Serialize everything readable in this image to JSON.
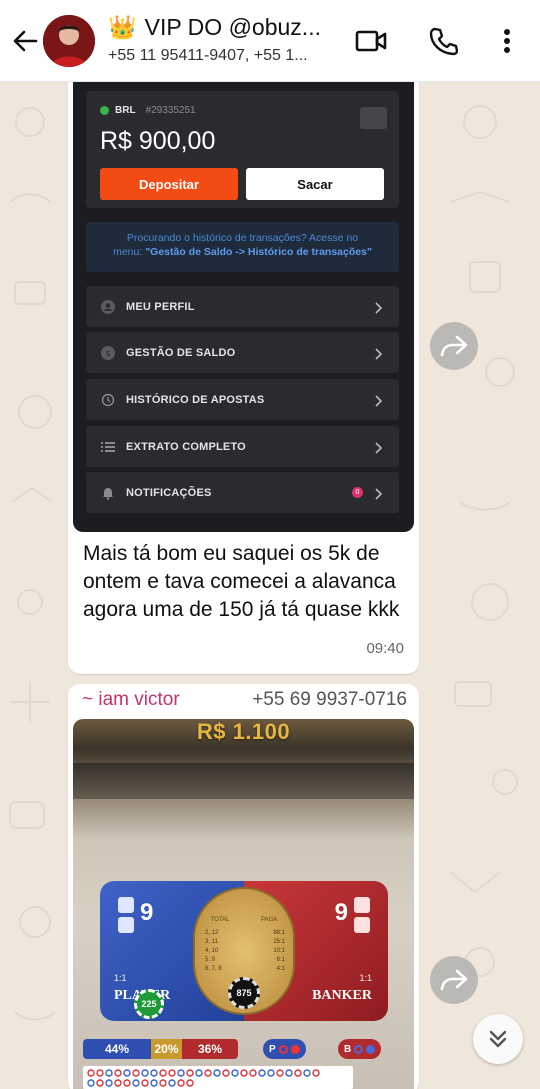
{
  "header": {
    "title": "VIP DO @obuz...",
    "title_emoji": "👑",
    "subtitle": "+55 11 95411-9407, +55 1...",
    "icons": [
      "back-arrow-icon",
      "video-call-icon",
      "voice-call-icon",
      "more-vert-icon"
    ]
  },
  "message1": {
    "screenshot": {
      "currency": "BRL",
      "account_id": "#29335251",
      "balance": "R$ 900,00",
      "deposit_label": "Depositar",
      "withdraw_label": "Sacar",
      "history_note_line1": "Procurando o histórico de transações? Acesse no",
      "history_note_line2_prefix": "menu: ",
      "history_note_line2_bold": "\"Gestão de Saldo -> Histórico de transações\"",
      "menu_items": [
        {
          "label": "MEU PERFIL",
          "icon": "user-icon"
        },
        {
          "label": "GESTÃO DE SALDO",
          "icon": "coin-icon"
        },
        {
          "label": "HISTÓRICO DE APOSTAS",
          "icon": "history-icon"
        },
        {
          "label": "EXTRATO COMPLETO",
          "icon": "list-icon"
        },
        {
          "label": "NOTIFICAÇÕES",
          "icon": "bell-icon",
          "badge": "0"
        }
      ]
    },
    "text": "Mais tá bom eu saquei os 5k de ontem e tava comecei a alavanca agora uma de 150 já tá quase kkk",
    "time": "09:40"
  },
  "message2": {
    "sender_name": "~ iam victor",
    "sender_phone": "+55 69 9937-0716",
    "screenshot": {
      "bet_amount": "R$ 1.100",
      "player_score": "9",
      "banker_score": "9",
      "player_label": "PLAYER",
      "banker_label": "BANKER",
      "player_odds": "1:1",
      "banker_odds": "1:1",
      "center_header_left": "TOTAL",
      "center_header_right": "PAGA",
      "center_rows": [
        {
          "total": "2, 12",
          "pays": "88:1"
        },
        {
          "total": "3, 11",
          "pays": "25:1"
        },
        {
          "total": "4, 10",
          "pays": "10:1"
        },
        {
          "total": "5, 9",
          "pays": "6:1"
        },
        {
          "total": "6, 7, 8",
          "pays": "4:1"
        }
      ],
      "chip_left": "225",
      "chip_center": "875",
      "stats": {
        "player_pct": "44%",
        "tie_pct": "20%",
        "banker_pct": "36%"
      },
      "player_pill": "P",
      "banker_pill": "B"
    }
  },
  "colors": {
    "chat_bg": "#efe7dc",
    "bubble": "#ffffff",
    "sender_name": "#c2336f",
    "deposit": "#f24b14",
    "player_blue": "#2f4fb3",
    "banker_red": "#b02a2e"
  }
}
